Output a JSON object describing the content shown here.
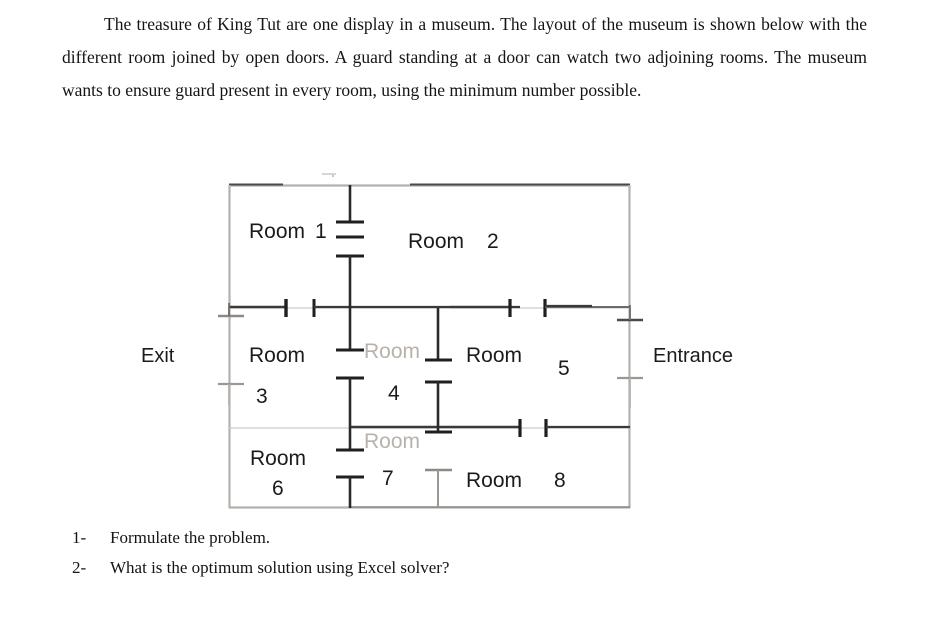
{
  "problem": {
    "paragraph": "The treasure of King Tut are one display in a museum. The layout of the museum is shown below with the different room joined by open doors. A guard standing at a door can watch two adjoining rooms. The museum wants to ensure guard present in every room, using the minimum number possible."
  },
  "figure": {
    "title": "museum-floor-plan",
    "exit_label": "Exit",
    "entrance_label": "Entrance",
    "rooms": [
      {
        "id": "room-1",
        "name": "Room",
        "number": "1",
        "faded": false
      },
      {
        "id": "room-2",
        "name": "Room",
        "number": "2",
        "faded": false
      },
      {
        "id": "room-3",
        "name": "Room",
        "number": "3",
        "faded": false
      },
      {
        "id": "room-4",
        "name": "Room",
        "number": "4",
        "faded": true
      },
      {
        "id": "room-5",
        "name": "Room",
        "number": "5",
        "faded": false
      },
      {
        "id": "room-6",
        "name": "Room",
        "number": "6",
        "faded": false
      },
      {
        "id": "room-7",
        "name": "Room",
        "number": "7",
        "faded": true
      },
      {
        "id": "room-8",
        "name": "Room",
        "number": "8",
        "faded": false
      }
    ],
    "colors": {
      "wall_dark": "#2a2a2a",
      "wall_light": "#b5b2ae",
      "text": "#1b1b1b",
      "faded_text": "#b9b2ab"
    }
  },
  "questions": [
    {
      "number": "1-",
      "text": "Formulate the problem."
    },
    {
      "number": "2-",
      "text": "What is the optimum solution using Excel solver?"
    }
  ]
}
